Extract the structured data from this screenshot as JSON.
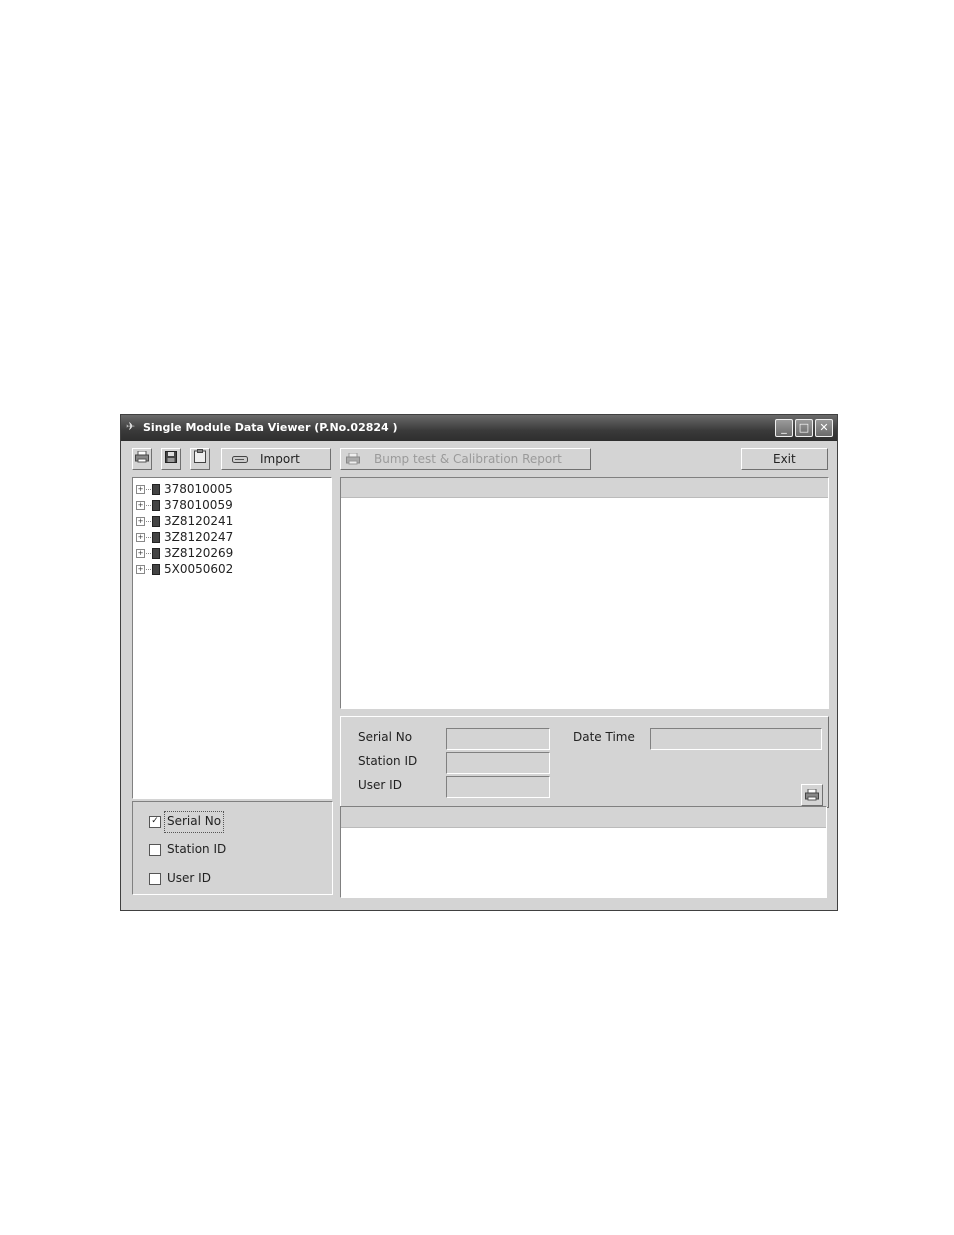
{
  "window": {
    "title": "Single Module Data Viewer (P.No.02824 )",
    "controls": [
      "_",
      "□",
      "✕"
    ]
  },
  "toolbar": {
    "print_icon": "printer-icon",
    "save_icon": "floppy-disk-icon",
    "clipboard_icon": "clipboard-icon",
    "import_label": "Import",
    "report_label": "Bump test & Calibration Report",
    "exit_label": "Exit"
  },
  "tree": {
    "items": [
      "378010005",
      "378010059",
      "3Z8120241",
      "3Z8120247",
      "3Z8120269",
      "5X0050602"
    ]
  },
  "filter": {
    "serial_label": "Serial No",
    "serial_checked": "✓",
    "station_label": "Station ID",
    "user_label": "User ID"
  },
  "details": {
    "serial_label": "Serial No",
    "station_label": "Station ID",
    "user_label": "User ID",
    "datetime_label": "Date Time",
    "serial_value": "",
    "station_value": "",
    "user_value": "",
    "datetime_value": ""
  }
}
